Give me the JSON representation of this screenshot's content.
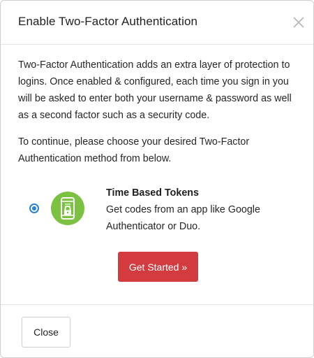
{
  "dialog": {
    "title": "Enable Two-Factor Authentication",
    "close_icon": "close-x-icon"
  },
  "body": {
    "intro": "Two-Factor Authentication adds an extra layer of protection to logins. Once enabled & configured, each time you sign in you will be asked to enter both your username & password as well as a second factor such as a security code.",
    "continue": "To continue, please choose your desired Two-Factor Authentication method from below."
  },
  "method": {
    "selected": true,
    "icon": "phone-lock-icon",
    "title": "Time Based Tokens",
    "description": "Get codes from an app like Google Authenticator or Duo."
  },
  "actions": {
    "get_started_label": "Get Started »",
    "close_label": "Close"
  },
  "colors": {
    "primary_button": "#d23c3f",
    "radio_accent": "#2a82d4",
    "icon_green": "#7cc242"
  }
}
